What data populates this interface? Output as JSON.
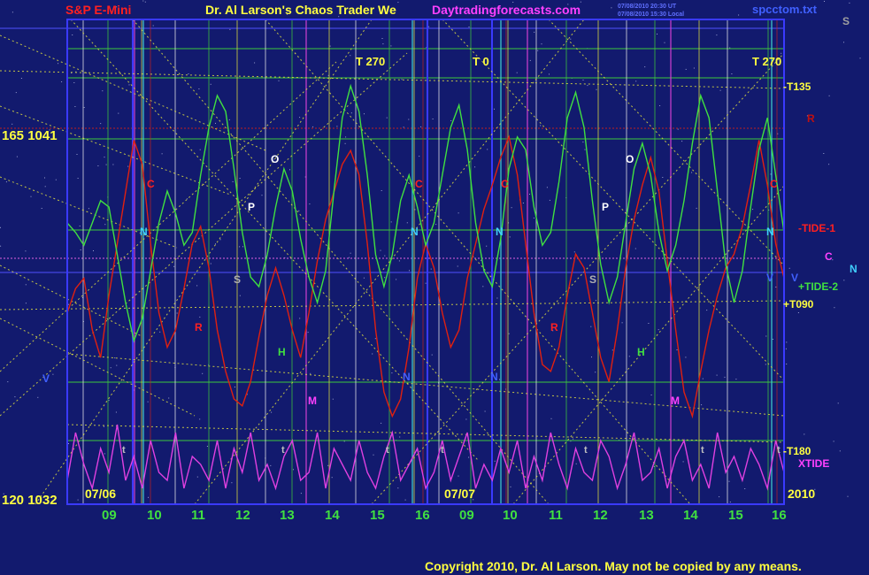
{
  "header": {
    "symbol": "S&P E-Mini",
    "title": "Dr. Al Larson's Chaos Trader We",
    "website": "Daytradingforecasts.com",
    "timestamp_1": "07/08/2010 20:30 UT",
    "timestamp_2": "07/08/2010 15:30 Local",
    "file": "spcctom.txt",
    "corner": "S"
  },
  "footer": {
    "copyright": "Copyright 2010, Dr. Al Larson. May not be copied by any means.",
    "year": "2010"
  },
  "colors": {
    "background": "#121a6e",
    "frame": "#3a3aff",
    "grid_green": "#3cc83c",
    "grid_yellow": "#e0e040",
    "vline_white": "#e8e8e8",
    "vline_magenta": "#d040d0",
    "vline_cyan": "#40d0d0",
    "hline_red": "#c02020",
    "hline_pink": "#e060e0",
    "hline_blue": "#5050ff",
    "diagonals": "#e0e040",
    "tide1": "#e02010",
    "tide2": "#40e040",
    "xtide": "#e040e0",
    "label_yellow": "#ffff40",
    "label_green": "#40e040",
    "label_cyan": "#40d0ff",
    "label_white": "#ffffff",
    "label_red": "#ff2020",
    "label_magenta": "#ff40ff",
    "copyright": "#ffff40"
  },
  "chart_data": {
    "type": "line",
    "title": "S&P E-Mini",
    "price_labels": {
      "top": "165  1041",
      "bottom": "120  1032"
    },
    "ylim": [
      1032,
      1041
    ],
    "x_dates": [
      "07/06",
      "07/07"
    ],
    "x_ticks": [
      "09",
      "10",
      "11",
      "12",
      "13",
      "14",
      "15",
      "16",
      "09",
      "10",
      "11",
      "12",
      "13",
      "14",
      "15",
      "16"
    ],
    "right_labels": [
      {
        "text": "-T135",
        "role": "level"
      },
      {
        "text": "R",
        "role": "marker"
      },
      {
        "text": "-TIDE-1",
        "role": "series"
      },
      {
        "text": "C",
        "role": "marker"
      },
      {
        "text": "N",
        "role": "marker"
      },
      {
        "text": "V",
        "role": "marker"
      },
      {
        "text": "+TIDE-2",
        "role": "series"
      },
      {
        "text": "+T090",
        "role": "level"
      },
      {
        "text": "-T180",
        "role": "level"
      },
      {
        "text": "XTIDE",
        "role": "series"
      }
    ],
    "time_markers_top": [
      {
        "letter": "T",
        "value": "270"
      },
      {
        "letter": "T",
        "value": "0"
      },
      {
        "letter": "T",
        "value": "270"
      }
    ],
    "event_letters": [
      {
        "text": "C",
        "color": "red"
      },
      {
        "text": "N",
        "color": "cyan"
      },
      {
        "text": "R",
        "color": "red"
      },
      {
        "text": "P",
        "color": "white"
      },
      {
        "text": "S",
        "color": "gray"
      },
      {
        "text": "O",
        "color": "white"
      },
      {
        "text": "H",
        "color": "green"
      },
      {
        "text": "M",
        "color": "magenta"
      },
      {
        "text": "C",
        "color": "red"
      },
      {
        "text": "N",
        "color": "cyan"
      },
      {
        "text": "N",
        "color": "cyan"
      },
      {
        "text": "C",
        "color": "red"
      },
      {
        "text": "V",
        "color": "blue"
      },
      {
        "text": "N",
        "color": "blue"
      },
      {
        "text": "N",
        "color": "blue"
      },
      {
        "text": "R",
        "color": "red"
      },
      {
        "text": "P",
        "color": "white"
      },
      {
        "text": "S",
        "color": "gray"
      },
      {
        "text": "O",
        "color": "white"
      },
      {
        "text": "H",
        "color": "green"
      },
      {
        "text": "M",
        "color": "magenta"
      },
      {
        "text": "C",
        "color": "red"
      },
      {
        "text": "N",
        "color": "cyan"
      },
      {
        "text": "V",
        "color": "blue"
      }
    ],
    "small_t_markers": [
      "t",
      "t",
      "t",
      "t",
      "t",
      "t",
      "t"
    ],
    "series": [
      {
        "name": "-TIDE-1",
        "values": [
          0.35,
          0.42,
          0.45,
          0.3,
          0.22,
          0.4,
          0.55,
          0.7,
          0.85,
          0.78,
          0.55,
          0.35,
          0.25,
          0.3,
          0.42,
          0.55,
          0.6,
          0.48,
          0.3,
          0.18,
          0.1,
          0.08,
          0.15,
          0.28,
          0.4,
          0.48,
          0.4,
          0.3,
          0.22,
          0.35,
          0.5,
          0.62,
          0.7,
          0.78,
          0.82,
          0.75,
          0.55,
          0.3,
          0.12,
          0.05,
          0.1,
          0.25,
          0.45,
          0.55,
          0.48,
          0.35,
          0.25,
          0.3,
          0.45,
          0.55,
          0.65,
          0.72,
          0.8,
          0.86,
          0.75,
          0.55,
          0.35,
          0.2,
          0.18,
          0.25,
          0.4,
          0.52,
          0.48,
          0.35,
          0.22,
          0.15,
          0.3,
          0.48,
          0.62,
          0.72,
          0.8,
          0.7,
          0.5,
          0.3,
          0.12,
          0.05,
          0.18,
          0.3,
          0.4,
          0.48,
          0.52,
          0.6,
          0.72,
          0.85,
          0.72,
          0.55,
          0.45
        ]
      },
      {
        "name": "+TIDE-2",
        "values": [
          0.55,
          0.52,
          0.48,
          0.55,
          0.62,
          0.6,
          0.45,
          0.3,
          0.18,
          0.25,
          0.4,
          0.55,
          0.65,
          0.58,
          0.48,
          0.52,
          0.7,
          0.85,
          0.95,
          0.9,
          0.72,
          0.52,
          0.38,
          0.35,
          0.45,
          0.6,
          0.72,
          0.65,
          0.5,
          0.38,
          0.3,
          0.4,
          0.65,
          0.88,
          0.98,
          0.9,
          0.7,
          0.45,
          0.35,
          0.45,
          0.62,
          0.7,
          0.6,
          0.48,
          0.55,
          0.7,
          0.85,
          0.92,
          0.78,
          0.55,
          0.4,
          0.35,
          0.5,
          0.72,
          0.82,
          0.78,
          0.6,
          0.48,
          0.52,
          0.68,
          0.88,
          0.96,
          0.85,
          0.62,
          0.42,
          0.3,
          0.38,
          0.55,
          0.72,
          0.8,
          0.7,
          0.52,
          0.4,
          0.48,
          0.62,
          0.8,
          0.95,
          0.88,
          0.65,
          0.42,
          0.3,
          0.4,
          0.6,
          0.78,
          0.88,
          0.7,
          0.52
        ]
      },
      {
        "name": "XTIDE",
        "values": [
          0.3,
          0.9,
          0.5,
          0.2,
          0.7,
          0.4,
          1.0,
          0.3,
          0.6,
          0.2,
          0.8,
          0.4,
          0.3,
          0.9,
          0.2,
          0.6,
          0.5,
          0.3,
          0.8,
          0.2,
          0.7,
          0.4,
          0.9,
          0.3,
          0.5,
          0.2,
          0.6,
          0.8,
          0.3,
          0.4,
          0.9,
          0.2,
          0.7,
          0.5,
          0.3,
          0.8,
          0.4,
          0.2,
          0.6,
          0.9,
          0.3,
          0.5,
          0.7,
          0.2,
          0.4,
          0.8,
          0.3,
          0.6,
          0.9,
          0.2,
          0.5,
          0.3,
          0.7,
          0.4,
          0.8,
          0.2,
          0.6,
          0.3,
          0.9,
          0.5,
          0.2,
          0.7,
          0.4,
          0.3,
          0.8,
          0.6,
          0.2,
          0.5,
          0.9,
          0.3,
          0.4,
          0.7,
          0.2,
          0.6,
          0.8,
          0.3,
          0.5,
          0.2,
          0.9,
          0.4,
          0.6,
          0.3,
          0.7,
          0.5,
          0.2,
          0.8,
          0.4
        ]
      }
    ],
    "grid": true,
    "legend": "right"
  }
}
